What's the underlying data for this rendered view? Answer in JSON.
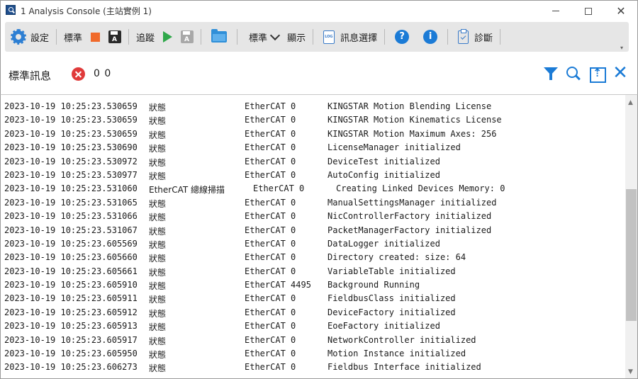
{
  "window": {
    "title": "1 Analysis Console (主站實例 1)"
  },
  "toolbar": {
    "settings_label": "設定",
    "standard_label_1": "標準",
    "trace_label": "追蹤",
    "standard_label_2": "標準",
    "display_label": "顯示",
    "message_select_label": "訊息選擇",
    "diagnose_label": "診斷"
  },
  "header": {
    "title": "標準訊息",
    "error_count": "0 0"
  },
  "log": {
    "rows": [
      {
        "time": "2023-10-19 10:25:23.530659",
        "type": "狀態",
        "source": "EtherCAT 0",
        "message": "KINGSTAR Motion Blending License"
      },
      {
        "time": "2023-10-19 10:25:23.530659",
        "type": "狀態",
        "source": "EtherCAT 0",
        "message": "KINGSTAR Motion Kinematics License"
      },
      {
        "time": "2023-10-19 10:25:23.530659",
        "type": "狀態",
        "source": "EtherCAT 0",
        "message": "KINGSTAR Motion Maximum Axes: 256"
      },
      {
        "time": "2023-10-19 10:25:23.530690",
        "type": "狀態",
        "source": "EtherCAT 0",
        "message": "LicenseManager initialized"
      },
      {
        "time": "2023-10-19 10:25:23.530972",
        "type": "狀態",
        "source": "EtherCAT 0",
        "message": "DeviceTest initialized"
      },
      {
        "time": "2023-10-19 10:25:23.530977",
        "type": "狀態",
        "source": "EtherCAT 0",
        "message": "AutoConfig initialized"
      },
      {
        "time": "2023-10-19 10:25:23.531060",
        "type": "EtherCAT 總線掃描",
        "source": "EtherCAT 0",
        "message": "Creating Linked Devices Memory: 0",
        "shift": true
      },
      {
        "time": "2023-10-19 10:25:23.531065",
        "type": "狀態",
        "source": "EtherCAT 0",
        "message": "ManualSettingsManager initialized"
      },
      {
        "time": "2023-10-19 10:25:23.531066",
        "type": "狀態",
        "source": "EtherCAT 0",
        "message": "NicControllerFactory initialized"
      },
      {
        "time": "2023-10-19 10:25:23.531067",
        "type": "狀態",
        "source": "EtherCAT 0",
        "message": "PacketManagerFactory initialized"
      },
      {
        "time": "2023-10-19 10:25:23.605569",
        "type": "狀態",
        "source": "EtherCAT 0",
        "message": "DataLogger initialized"
      },
      {
        "time": "2023-10-19 10:25:23.605660",
        "type": "狀態",
        "source": "EtherCAT 0",
        "message": "Directory created: size: 64"
      },
      {
        "time": "2023-10-19 10:25:23.605661",
        "type": "狀態",
        "source": "EtherCAT 0",
        "message": "VariableTable initialized"
      },
      {
        "time": "2023-10-19 10:25:23.605910",
        "type": "狀態",
        "source": "EtherCAT 4495",
        "message": "Background Running"
      },
      {
        "time": "2023-10-19 10:25:23.605911",
        "type": "狀態",
        "source": "EtherCAT 0",
        "message": "FieldbusClass initialized"
      },
      {
        "time": "2023-10-19 10:25:23.605912",
        "type": "狀態",
        "source": "EtherCAT 0",
        "message": "DeviceFactory initialized"
      },
      {
        "time": "2023-10-19 10:25:23.605913",
        "type": "狀態",
        "source": "EtherCAT 0",
        "message": "EoeFactory initialized"
      },
      {
        "time": "2023-10-19 10:25:23.605917",
        "type": "狀態",
        "source": "EtherCAT 0",
        "message": "NetworkController initialized"
      },
      {
        "time": "2023-10-19 10:25:23.605950",
        "type": "狀態",
        "source": "EtherCAT 0",
        "message": "Motion Instance initialized"
      },
      {
        "time": "2023-10-19 10:25:23.606273",
        "type": "狀態",
        "source": "EtherCAT 0",
        "message": "Fieldbus Interface initialized"
      }
    ]
  }
}
